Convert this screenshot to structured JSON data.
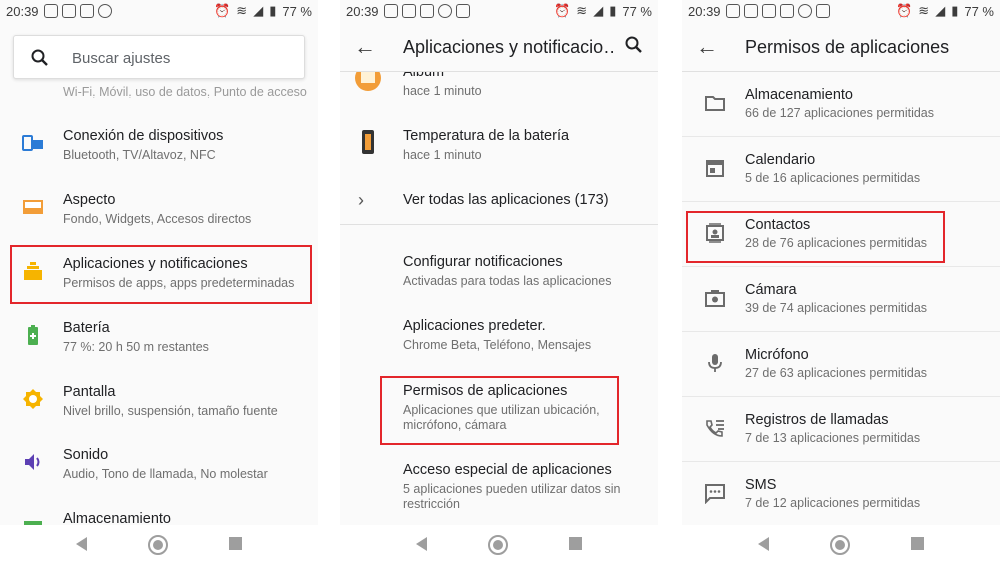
{
  "phone1": {
    "status": {
      "time": "20:39",
      "battery": "77 %"
    },
    "search": {
      "placeholder": "Buscar ajustes"
    },
    "cut_subtitle": "Wi-Fi, Móvil, uso de datos, Punto de acceso",
    "items": [
      {
        "title": "Conexión de dispositivos",
        "subtitle": "Bluetooth, TV/Altavoz, NFC",
        "icon": "devices-icon",
        "color": "#2b7bd6"
      },
      {
        "title": "Aspecto",
        "subtitle": "Fondo, Widgets, Accesos directos",
        "icon": "wallpaper-icon",
        "color": "#f29d38"
      },
      {
        "title": "Aplicaciones y notificaciones",
        "subtitle": "Permisos de apps, apps predeterminadas",
        "icon": "apps-icon",
        "color": "#f6b400"
      },
      {
        "title": "Batería",
        "subtitle": "77 %: 20 h  50 m restantes",
        "icon": "battery-icon",
        "color": "#4caf50"
      },
      {
        "title": "Pantalla",
        "subtitle": "Nivel brillo, suspensión, tamaño fuente",
        "icon": "brightness-icon",
        "color": "#f6b400"
      },
      {
        "title": "Sonido",
        "subtitle": "Audio, Tono de llamada, No molestar",
        "icon": "volume-icon",
        "color": "#5c3fb3"
      },
      {
        "title": "Almacenamiento",
        "subtitle": "",
        "icon": "storage-icon",
        "color": "#4caf50"
      }
    ]
  },
  "phone2": {
    "status": {
      "time": "20:39",
      "battery": "77 %"
    },
    "title": "Aplicaciones y notificacio…",
    "items_top": [
      {
        "title": "Álbum",
        "subtitle": "hace 1 minuto",
        "icon": "album-icon"
      },
      {
        "title": "Temperatura de la batería",
        "subtitle": "hace 1 minuto",
        "icon": "thermometer-icon"
      },
      {
        "title": "Ver todas las aplicaciones (173)",
        "subtitle": "",
        "icon": "chevron-right-icon"
      }
    ],
    "items": [
      {
        "title": "Configurar notificaciones",
        "subtitle": "Activadas para todas las aplicaciones"
      },
      {
        "title": "Aplicaciones predeter.",
        "subtitle": "Chrome Beta, Teléfono, Mensajes"
      },
      {
        "title": "Permisos de aplicaciones",
        "subtitle": "Aplicaciones que utilizan ubicación, micrófono, cámara"
      },
      {
        "title": "Acceso especial de aplicaciones",
        "subtitle": "5 aplicaciones pueden utilizar datos sin restricción"
      }
    ]
  },
  "phone3": {
    "status": {
      "time": "20:39",
      "battery": "77 %"
    },
    "title": "Permisos de aplicaciones",
    "items": [
      {
        "title": "Almacenamiento",
        "subtitle": "66 de 127 aplicaciones permitidas",
        "icon": "folder-icon"
      },
      {
        "title": "Calendario",
        "subtitle": "5 de 16 aplicaciones permitidas",
        "icon": "calendar-icon"
      },
      {
        "title": "Contactos",
        "subtitle": "28 de 76 aplicaciones permitidas",
        "icon": "contacts-icon"
      },
      {
        "title": "Cámara",
        "subtitle": "39 de 74 aplicaciones permitidas",
        "icon": "camera-icon"
      },
      {
        "title": "Micrófono",
        "subtitle": "27 de 63 aplicaciones permitidas",
        "icon": "microphone-icon"
      },
      {
        "title": "Registros de llamadas",
        "subtitle": "7 de 13 aplicaciones permitidas",
        "icon": "call-log-icon"
      },
      {
        "title": "SMS",
        "subtitle": "7 de 12 aplicaciones permitidas",
        "icon": "sms-icon"
      }
    ]
  },
  "colors": {
    "highlight": "#e3262b",
    "icon_gray": "#6b6b6b"
  }
}
